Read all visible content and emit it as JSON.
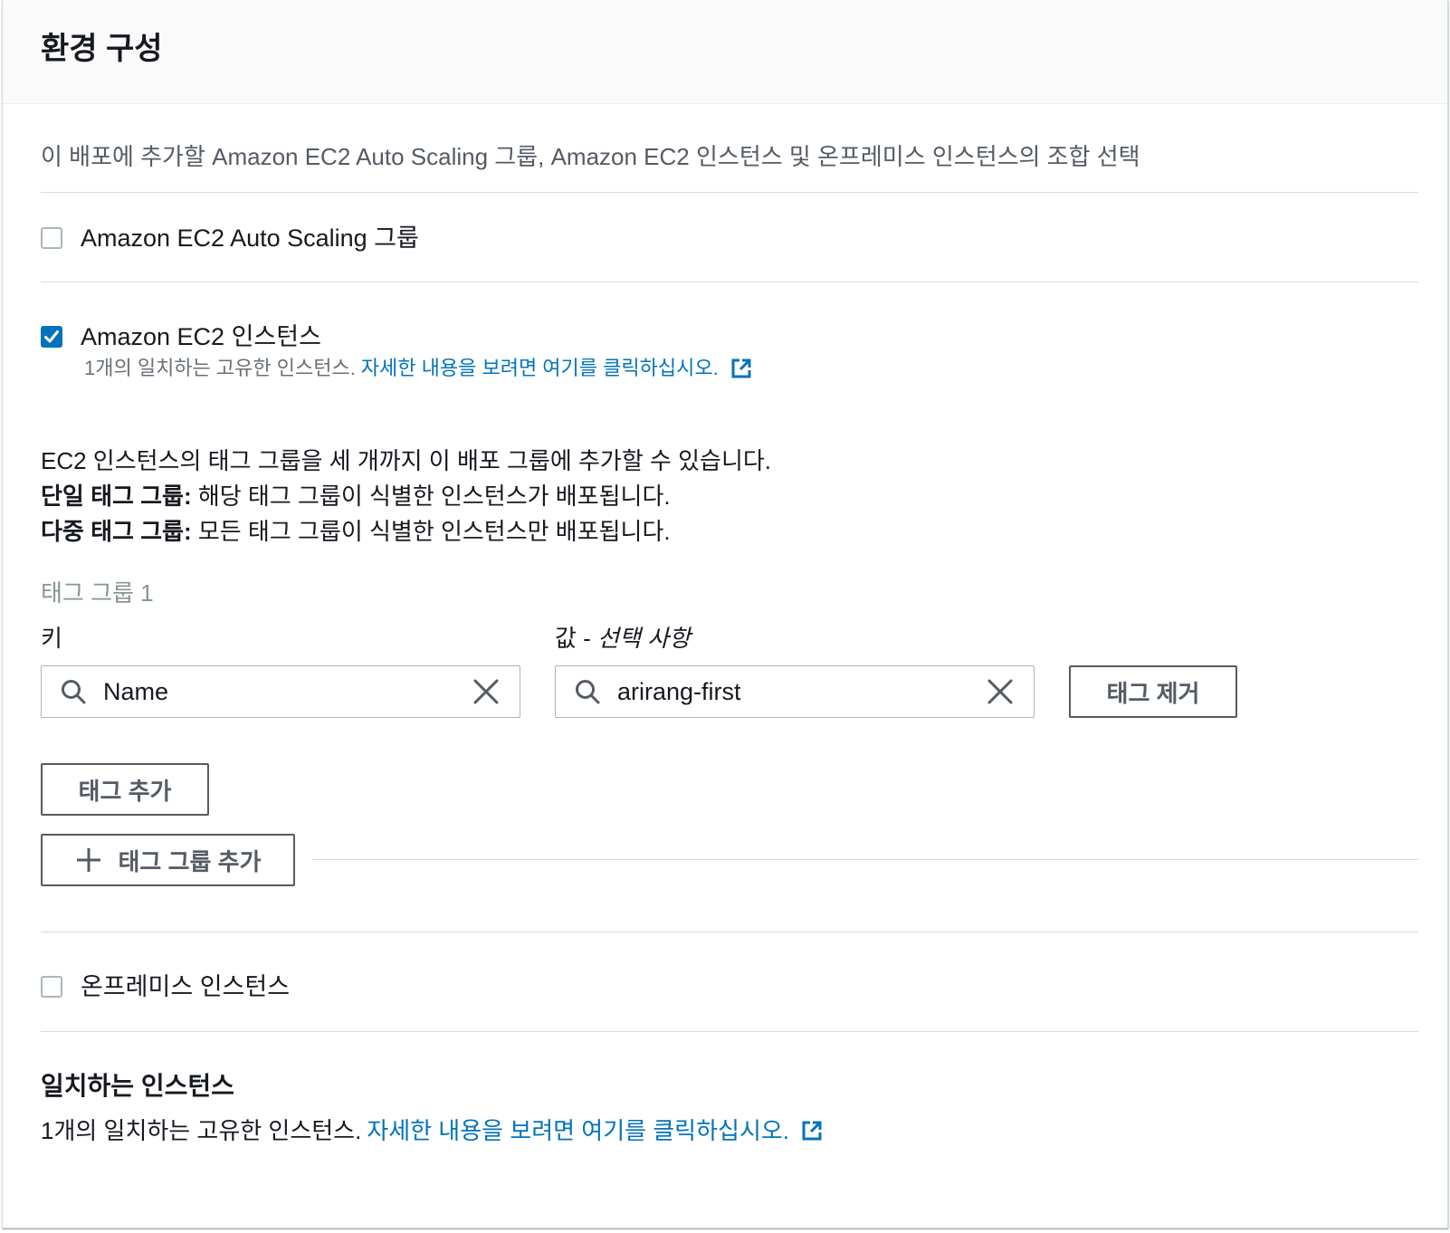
{
  "header": {
    "title": "환경 구성"
  },
  "description": "이 배포에 추가할 Amazon EC2 Auto Scaling 그룹, Amazon EC2 인스턴스 및 온프레미스 인스턴스의 조합 선택",
  "options": {
    "asg": {
      "label": "Amazon EC2 Auto Scaling 그룹",
      "checked": false
    },
    "ec2": {
      "label": "Amazon EC2 인스턴스",
      "checked": true,
      "match_text": "1개의 일치하는 고유한 인스턴스.",
      "link_text": "자세한 내용을 보려면 여기를 클릭하십시오."
    },
    "onprem": {
      "label": "온프레미스 인스턴스",
      "checked": false
    }
  },
  "info": {
    "line1": "EC2 인스턴스의 태그 그룹을 세 개까지 이 배포 그룹에 추가할 수 있습니다.",
    "single_label": "단일 태그 그룹:",
    "single_text": " 해당 태그 그룹이 식별한 인스턴스가 배포됩니다.",
    "multi_label": "다중 태그 그룹:",
    "multi_text": " 모든 태그 그룹이 식별한 인스턴스만 배포됩니다."
  },
  "tag_group": {
    "title": "태그 그룹 1",
    "key_label": "키",
    "value_label_prefix": "값 - ",
    "value_label_optional": "선택 사항",
    "key_value": "Name",
    "value_value": "arirang-first",
    "remove_tag_label": "태그 제거",
    "add_tag_label": "태그 추가",
    "add_group_label": "태그 그룹 추가"
  },
  "matching": {
    "title": "일치하는 인스턴스",
    "text": "1개의 일치하는 고유한 인스턴스.",
    "link_text": "자세한 내용을 보려면 여기를 클릭하십시오."
  },
  "colors": {
    "link": "#0073bb",
    "checkbox_checked": "#0073bb",
    "border": "#aab7b8",
    "text": "#16191f"
  },
  "icons": [
    "search-icon",
    "close-icon",
    "external-link-icon",
    "plus-icon",
    "check-icon"
  ]
}
